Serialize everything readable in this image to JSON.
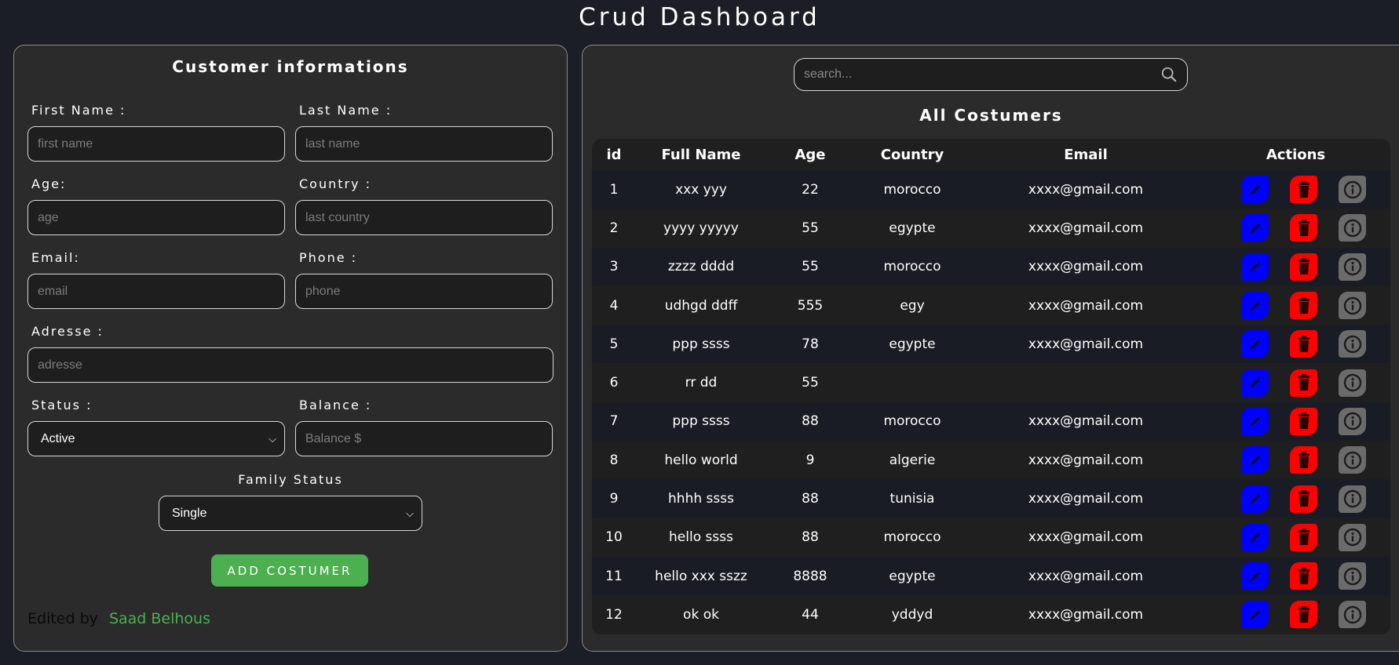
{
  "header": {
    "title": "Crud Dashboard"
  },
  "form": {
    "title": "Customer informations",
    "fields": {
      "first_name": {
        "label": "First Name :",
        "placeholder": "first name"
      },
      "last_name": {
        "label": "Last Name :",
        "placeholder": "last name"
      },
      "age": {
        "label": "Age:",
        "placeholder": "age"
      },
      "country": {
        "label": "Country :",
        "placeholder": "last country"
      },
      "email": {
        "label": "Email:",
        "placeholder": "email"
      },
      "phone": {
        "label": "Phone :",
        "placeholder": "phone"
      },
      "adresse": {
        "label": "Adresse :",
        "placeholder": "adresse"
      },
      "status": {
        "label": "Status :",
        "selected": "Active"
      },
      "balance": {
        "label": "Balance :",
        "placeholder": "Balance $"
      },
      "family_status": {
        "label": "Family Status",
        "selected": "Single"
      }
    },
    "submit_label": "ADD COSTUMER",
    "footer": {
      "prefix": "Edited by",
      "author": "Saad Belhous"
    }
  },
  "customers": {
    "search_placeholder": "search...",
    "title": "All Costumers",
    "columns": {
      "id": "id",
      "full_name": "Full Name",
      "age": "Age",
      "country": "Country",
      "email": "Email",
      "actions": "Actions"
    },
    "rows": [
      {
        "id": "1",
        "full_name": "xxx yyy",
        "age": "22",
        "country": "morocco",
        "email": "xxxx@gmail.com"
      },
      {
        "id": "2",
        "full_name": "yyyy yyyyy",
        "age": "55",
        "country": "egypte",
        "email": "xxxx@gmail.com"
      },
      {
        "id": "3",
        "full_name": "zzzz dddd",
        "age": "55",
        "country": "morocco",
        "email": "xxxx@gmail.com"
      },
      {
        "id": "4",
        "full_name": "udhgd ddff",
        "age": "555",
        "country": "egy",
        "email": "xxxx@gmail.com"
      },
      {
        "id": "5",
        "full_name": "ppp ssss",
        "age": "78",
        "country": "egypte",
        "email": "xxxx@gmail.com"
      },
      {
        "id": "6",
        "full_name": "rr dd",
        "age": "55",
        "country": "",
        "email": ""
      },
      {
        "id": "7",
        "full_name": "ppp ssss",
        "age": "88",
        "country": "morocco",
        "email": "xxxx@gmail.com"
      },
      {
        "id": "8",
        "full_name": "hello world",
        "age": "9",
        "country": "algerie",
        "email": "xxxx@gmail.com"
      },
      {
        "id": "9",
        "full_name": "hhhh ssss",
        "age": "88",
        "country": "tunisia",
        "email": "xxxx@gmail.com"
      },
      {
        "id": "10",
        "full_name": "hello ssss",
        "age": "88",
        "country": "morocco",
        "email": "xxxx@gmail.com"
      },
      {
        "id": "11",
        "full_name": "hello xxx sszz",
        "age": "8888",
        "country": "egypte",
        "email": "xxxx@gmail.com"
      },
      {
        "id": "12",
        "full_name": "ok ok",
        "age": "44",
        "country": "yddyd",
        "email": "xxxx@gmail.com"
      }
    ]
  },
  "icons": {
    "search": "search-icon",
    "edit": "pencil-icon",
    "delete": "trash-icon",
    "info": "info-icon"
  },
  "colors": {
    "background": "#1b1e26",
    "panel": "#2b2b2b",
    "accent_green": "#4caf50",
    "edit": "#0000ff",
    "delete": "#ff0000",
    "info": "#6b6b6b"
  }
}
